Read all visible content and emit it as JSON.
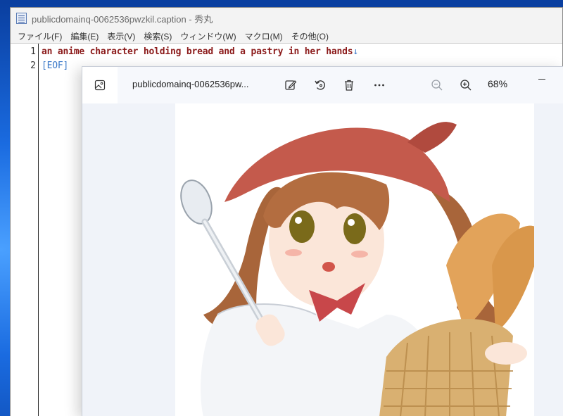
{
  "editor": {
    "title": "publicdomainq-0062536pwzkil.caption  - 秀丸",
    "menu": [
      {
        "label": "ファイル(F)"
      },
      {
        "label": "編集(E)"
      },
      {
        "label": "表示(V)"
      },
      {
        "label": "検索(S)"
      },
      {
        "label": "ウィンドウ(W)"
      },
      {
        "label": "マクロ(M)"
      },
      {
        "label": "その他(O)"
      }
    ],
    "lines": [
      {
        "number": "1",
        "text": "an anime character holding bread and a pastry in her hands",
        "eol": "↓"
      },
      {
        "number": "2",
        "text": "",
        "eol": "[EOF]"
      }
    ]
  },
  "viewer": {
    "file_name": "publicdomainq-0062536pw...",
    "zoom": "68%",
    "icons": {
      "thumbnail": "image-icon",
      "edit": "edit-image-icon",
      "rotate": "rotate-icon",
      "delete": "delete-icon",
      "more": "more-icon",
      "zoom_out": "zoom-out-icon",
      "zoom_in": "zoom-in-icon",
      "minimize": "minimize-icon"
    }
  },
  "colors": {
    "text_red": "#8b1a1a",
    "marker_blue": "#3a78c8",
    "viewer_bg": "#f0f3f9"
  }
}
